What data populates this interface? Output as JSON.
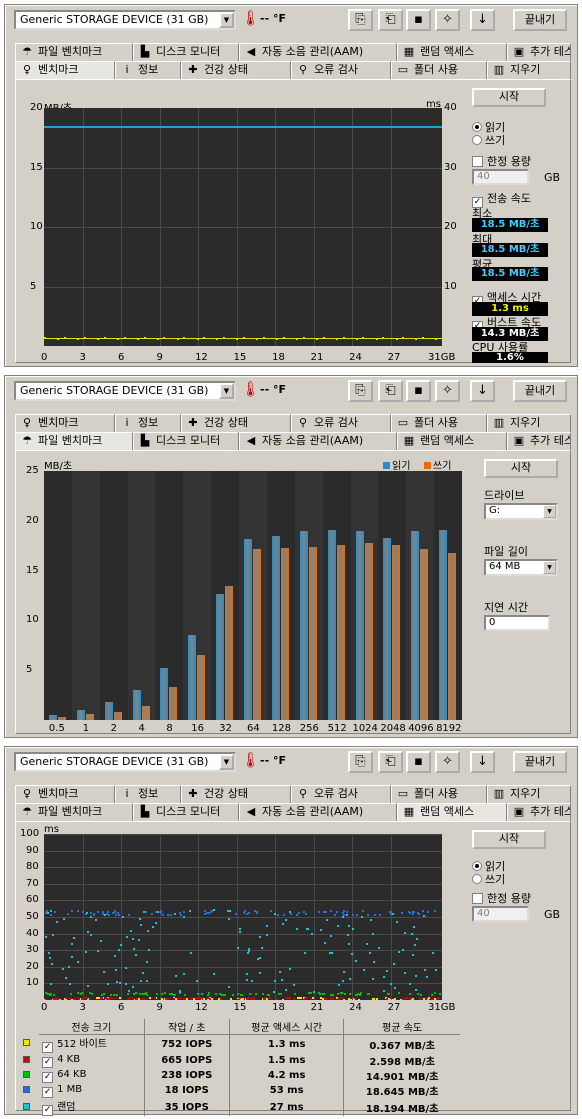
{
  "toolbar": {
    "drive": "Generic STORAGE DEVICE    (31 GB)",
    "temp": "-- °F",
    "exit": "끝내기"
  },
  "tabs_a": [
    {
      "label": "파일 벤치마크",
      "icon": "file-bench-icon",
      "glyph": "☂"
    },
    {
      "label": "디스크 모니터",
      "icon": "disk-monitor-icon",
      "glyph": "▙"
    },
    {
      "label": "자동 소음 관리(AAM)",
      "icon": "speaker-icon",
      "glyph": "◀"
    },
    {
      "label": "랜덤 액세스",
      "icon": "random-access-icon",
      "glyph": "▦"
    },
    {
      "label": "추가 테스트",
      "icon": "extra-test-icon",
      "glyph": "▣"
    }
  ],
  "tabs_b": [
    {
      "label": "벤치마크",
      "icon": "benchmark-icon",
      "glyph": "♀"
    },
    {
      "label": "정보",
      "icon": "info-icon",
      "glyph": "i"
    },
    {
      "label": "건강 상태",
      "icon": "health-cross-icon",
      "glyph": "✚"
    },
    {
      "label": "오류 검사",
      "icon": "magnifier-icon",
      "glyph": "⚲"
    },
    {
      "label": "폴더 사용",
      "icon": "folder-icon",
      "glyph": "▭"
    },
    {
      "label": "지우기",
      "icon": "trash-icon",
      "glyph": "▥"
    }
  ],
  "bench": {
    "start": "시작",
    "read": "읽기",
    "write": "쓰기",
    "limit": "한정 용량",
    "limit_val": "40",
    "gb": "GB",
    "transfer": "전송 속도",
    "min_label": "최소",
    "min": "18.5 MB/초",
    "max_label": "최대",
    "max": "18.5 MB/초",
    "avg_label": "평균",
    "avg": "18.5 MB/초",
    "access": "액세스 시간",
    "access_val": "1.3 ms",
    "burst": "버스트 속도",
    "burst_val": "14.3 MB/초",
    "cpu": "CPU 사용률",
    "cpu_val": "1.6%",
    "y_unit": "MB/초",
    "y2_unit": "ms",
    "x_last": "31GB"
  },
  "filebench": {
    "start": "시작",
    "drive_label": "드라이브",
    "drive_val": "G:",
    "len_label": "파일 길이",
    "len_val": "64 MB",
    "delay_label": "지연 시간",
    "delay_val": "0",
    "y_unit": "MB/초",
    "legend_read": "읽기",
    "legend_write": "쓰기"
  },
  "random": {
    "start": "시작",
    "read": "읽기",
    "write": "쓰기",
    "limit": "한정 용량",
    "limit_val": "40",
    "gb": "GB",
    "y_unit": "ms",
    "x_last": "31GB",
    "headers": [
      "전송 크기",
      "작업 / 초",
      "평균 액세스 시간",
      "평균 속도"
    ],
    "rows": [
      {
        "color": "#e8e800",
        "size": "512 바이트",
        "iops": "752 IOPS",
        "acc": "1.3 ms",
        "speed": "0.367 MB/초"
      },
      {
        "color": "#d00000",
        "size": "4 KB",
        "iops": "665 IOPS",
        "acc": "1.5 ms",
        "speed": "2.598 MB/초"
      },
      {
        "color": "#00c000",
        "size": "64 KB",
        "iops": "238 IOPS",
        "acc": "4.2 ms",
        "speed": "14.901 MB/초"
      },
      {
        "color": "#2070e0",
        "size": "1 MB",
        "iops": "18 IOPS",
        "acc": "53 ms",
        "speed": "18.645 MB/초"
      },
      {
        "color": "#20c0d0",
        "size": "랜덤",
        "iops": "35 IOPS",
        "acc": "27 ms",
        "speed": "18.194 MB/초"
      }
    ]
  },
  "chart_data": [
    {
      "type": "line",
      "title": "",
      "ylabel": "MB/초",
      "y2label": "ms",
      "ylim": [
        0,
        20
      ],
      "y2lim": [
        0,
        40
      ],
      "x_ticks": [
        "0",
        "3",
        "6",
        "9",
        "12",
        "15",
        "18",
        "21",
        "24",
        "27",
        "31GB"
      ],
      "y_ticks": [
        "20",
        "15",
        "10",
        "5"
      ],
      "y2_ticks": [
        "40",
        "30",
        "20",
        "10"
      ],
      "series": [
        {
          "name": "전송 속도",
          "color": "#20a0d0",
          "x": [
            0,
            31
          ],
          "y": [
            18.5,
            18.5
          ]
        },
        {
          "name": "액세스 시간",
          "color": "#e0e000",
          "x": [
            0,
            31
          ],
          "y": [
            1.3,
            1.3
          ]
        }
      ]
    },
    {
      "type": "bar",
      "ylabel": "MB/초",
      "ylim": [
        0,
        25
      ],
      "categories": [
        "0.5",
        "1",
        "2",
        "4",
        "8",
        "16",
        "32",
        "64",
        "128",
        "256",
        "512",
        "1024",
        "2048",
        "4096",
        "8192"
      ],
      "y_ticks": [
        "25",
        "20",
        "15",
        "10",
        "5"
      ],
      "series": [
        {
          "name": "읽기",
          "color": "#1e90d0",
          "values": [
            0.5,
            1,
            1.8,
            3,
            5.2,
            8.5,
            12.7,
            18.2,
            18.5,
            19,
            19.1,
            19,
            18.3,
            19,
            19.1
          ]
        },
        {
          "name": "쓰기",
          "color": "#e07010",
          "values": [
            0.3,
            0.6,
            0.8,
            1.4,
            3.3,
            6.5,
            13.5,
            17.2,
            17.3,
            17.4,
            17.6,
            17.8,
            17.6,
            17.2,
            16.8
          ]
        }
      ]
    },
    {
      "type": "scatter",
      "ylabel": "ms",
      "ylim": [
        0,
        100
      ],
      "y_ticks": [
        "100",
        "90",
        "80",
        "70",
        "60",
        "50",
        "40",
        "30",
        "20",
        "10"
      ],
      "x_ticks": [
        "0",
        "3",
        "6",
        "9",
        "12",
        "15",
        "18",
        "21",
        "24",
        "27",
        "31GB"
      ],
      "series": [
        {
          "name": "512 바이트",
          "color": "#e8e800",
          "y": 1.3
        },
        {
          "name": "4 KB",
          "color": "#d00000",
          "y": 1.5
        },
        {
          "name": "64 KB",
          "color": "#00c000",
          "y": 4.2
        },
        {
          "name": "1 MB",
          "color": "#2070e0",
          "y": 53
        },
        {
          "name": "랜덤",
          "color": "#20c0d0",
          "y": 27
        }
      ]
    }
  ]
}
